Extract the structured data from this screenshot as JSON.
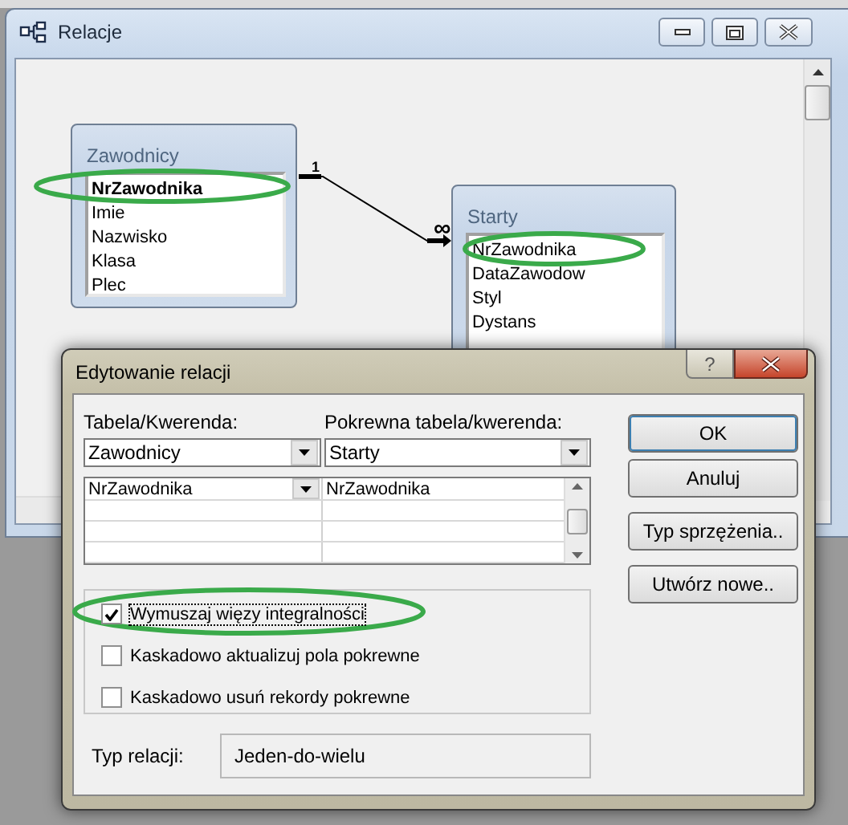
{
  "window": {
    "title": "Relacje"
  },
  "tables": [
    {
      "title": "Zawodnicy",
      "fields": [
        {
          "name": "NrZawodnika",
          "key": true,
          "circled": true
        },
        {
          "name": "Imie",
          "key": false,
          "circled": false
        },
        {
          "name": "Nazwisko",
          "key": false,
          "circled": false
        },
        {
          "name": "Klasa",
          "key": false,
          "circled": false
        },
        {
          "name": "Plec",
          "key": false,
          "circled": false
        }
      ]
    },
    {
      "title": "Starty",
      "fields": [
        {
          "name": "NrZawodnika",
          "key": false,
          "circled": true
        },
        {
          "name": "DataZawodow",
          "key": false,
          "circled": false
        },
        {
          "name": "Styl",
          "key": false,
          "circled": false
        },
        {
          "name": "Dystans",
          "key": false,
          "circled": false
        }
      ]
    }
  ],
  "relationship": {
    "one_label": "1",
    "many_label": "∞"
  },
  "dialog": {
    "title": "Edytowanie relacji",
    "help_button": "?",
    "table_label": "Tabela/Kwerenda:",
    "related_label": "Pokrewna tabela/kwerenda:",
    "table_value": "Zawodnicy",
    "related_value": "Starty",
    "field_rows": [
      {
        "left": "NrZawodnika",
        "right": "NrZawodnika"
      }
    ],
    "buttons": [
      {
        "label": "OK"
      },
      {
        "label": "Anuluj"
      },
      {
        "label": "Typ sprzężenia.."
      },
      {
        "label": "Utwórz nowe.."
      }
    ],
    "options": [
      {
        "label": "Wymuszaj więzy integralności",
        "checked": true,
        "circled": true
      },
      {
        "label": "Kaskadowo aktualizuj pola pokrewne",
        "checked": false,
        "circled": false
      },
      {
        "label": "Kaskadowo usuń rekordy pokrewne",
        "checked": false,
        "circled": false
      }
    ],
    "relation_type_label": "Typ relacji:",
    "relation_type": "Jeden-do-wielu"
  }
}
